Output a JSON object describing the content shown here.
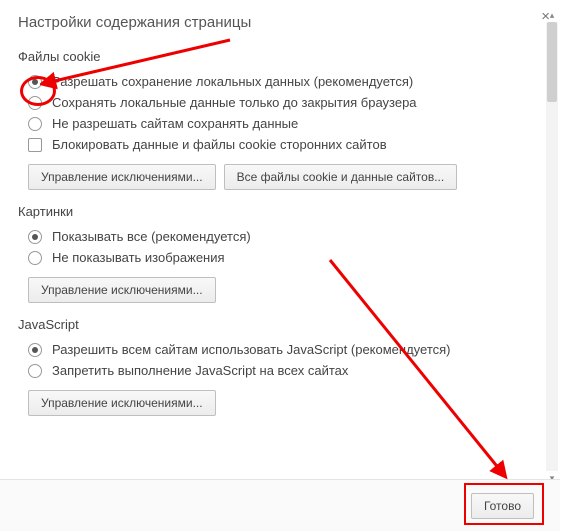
{
  "dialog": {
    "title": "Настройки содержания страницы",
    "close": "×"
  },
  "cookies": {
    "title": "Файлы cookie",
    "opt1": "Разрешать сохранение локальных данных (рекомендуется)",
    "opt2": "Сохранять локальные данные только до закрытия браузера",
    "opt3": "Не разрешать сайтам сохранять данные",
    "opt4": "Блокировать данные и файлы cookie сторонних сайтов",
    "btn_exceptions": "Управление исключениями...",
    "btn_all": "Все файлы cookie и данные сайтов..."
  },
  "images": {
    "title": "Картинки",
    "opt1": "Показывать все (рекомендуется)",
    "opt2": "Не показывать изображения",
    "btn_exceptions": "Управление исключениями..."
  },
  "javascript": {
    "title": "JavaScript",
    "opt1": "Разрешить всем сайтам использовать JavaScript (рекомендуется)",
    "opt2": "Запретить выполнение JavaScript на всех сайтах",
    "btn_exceptions": "Управление исключениями..."
  },
  "footer": {
    "done": "Готово"
  }
}
